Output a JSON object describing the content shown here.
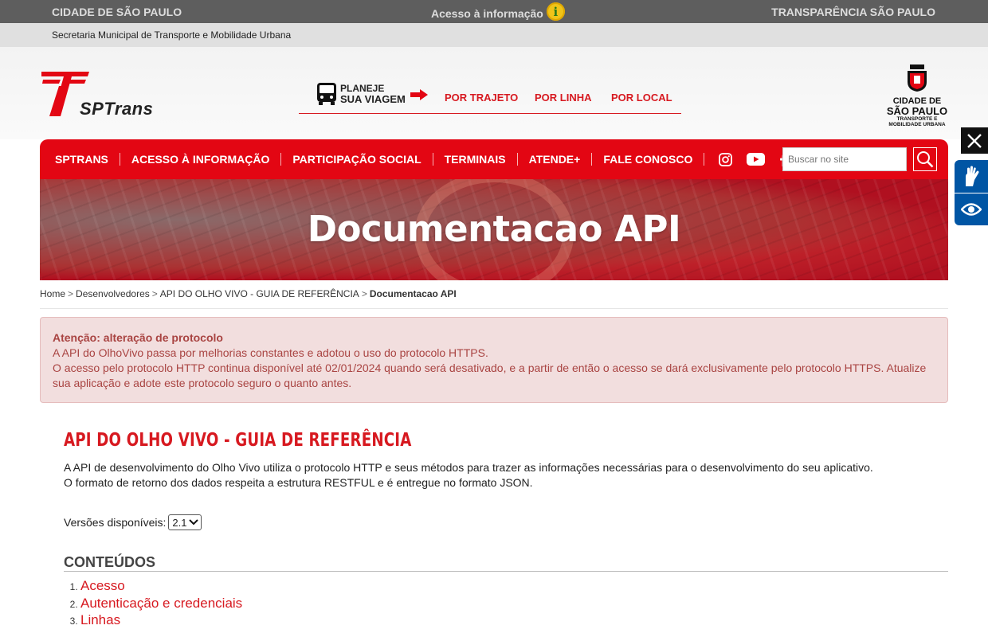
{
  "govbar": {
    "left": "CIDADE DE SÃO PAULO",
    "middle": "Acesso à informação",
    "right": "TRANSPARÊNCIA SÃO PAULO"
  },
  "subbar": {
    "text": "Secretaria Municipal de Transporte e Mobilidade Urbana"
  },
  "header": {
    "logo_text": "SPTrans",
    "planeje_line1": "PLANEJE",
    "planeje_line2": "SUA VIAGEM",
    "plan_links": [
      "POR TRAJETO",
      "POR LINHA",
      "POR LOCAL"
    ],
    "city_logo": {
      "line1": "CIDADE DE",
      "line2": "SÃO PAULO",
      "line3": "TRANSPORTE E",
      "line4": "MOBILIDADE URBANA"
    }
  },
  "nav": {
    "items": [
      "SPTRANS",
      "ACESSO À INFORMAÇÃO",
      "PARTICIPAÇÃO SOCIAL",
      "TERMINAIS",
      "ATENDE+",
      "FALE CONOSCO"
    ],
    "social_icons": [
      "instagram-icon",
      "youtube-icon",
      "facebook-icon",
      "x-icon"
    ],
    "search_placeholder": "Buscar no site"
  },
  "banner": {
    "title": "Documentacao API"
  },
  "breadcrumb": {
    "items": [
      "Home",
      "Desenvolvedores",
      "API DO OLHO VIVO - GUIA DE REFERÊNCIA"
    ],
    "current": "Documentacao API",
    "separator": ">"
  },
  "alert": {
    "title": "Atenção: alteração de protocolo",
    "line1": "A API do OlhoVivo passa por melhorias constantes e adotou o uso do protocolo HTTPS.",
    "line2": "O acesso pelo protocolo HTTP continua disponível até 02/01/2024 quando será desativado, e a partir de então o acesso se dará exclusivamente pelo protocolo HTTPS. Atualize sua aplicação e adote este protocolo seguro o quanto antes."
  },
  "main": {
    "title": "API DO OLHO VIVO - GUIA DE REFERÊNCIA",
    "desc_line1": "A API de desenvolvimento do Olho Vivo utiliza o protocolo HTTP e seus métodos para trazer as informações necessárias para o desenvolvimento do seu aplicativo.",
    "desc_line2": "O formato de retorno dos dados respeita a estrutura RESTFUL e é entregue no formato JSON.",
    "versions_label": "Versões disponíveis:",
    "version_selected": "2.1",
    "contents_heading": "CONTEÚDOS",
    "contents": [
      "Acesso",
      "Autenticação e credenciais",
      "Linhas"
    ]
  },
  "colors": {
    "brand_red": "#e30613",
    "accessibility_blue": "#0055a4",
    "alert_text": "#a94442"
  }
}
